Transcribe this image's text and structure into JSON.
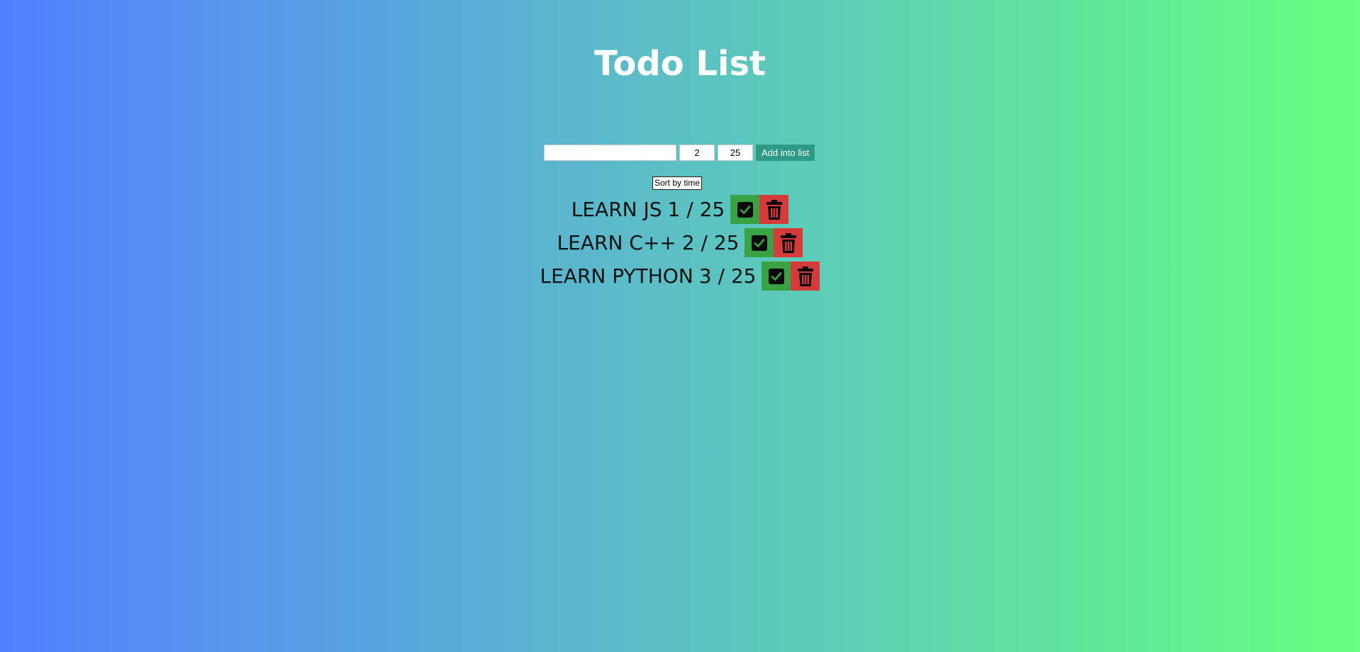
{
  "header": {
    "title": "Todo List"
  },
  "form": {
    "task_value": "",
    "time_value": "2",
    "total_value": "25",
    "add_label": "Add into list"
  },
  "sort": {
    "label": "Sort by time"
  },
  "todos": [
    {
      "name": "LEARN JS",
      "progress": "1 / 25"
    },
    {
      "name": "LEARN C++",
      "progress": "2 / 25"
    },
    {
      "name": "LEARN PYTHON",
      "progress": "3 / 25"
    }
  ],
  "icons": {
    "complete": "check-square-icon",
    "delete": "trash-icon"
  },
  "colors": {
    "gradient_start": "#5280ff",
    "gradient_end": "#66ff7f",
    "add_button": "#2d9a86",
    "complete_button": "#3aa244",
    "delete_button": "#d63a3a"
  }
}
